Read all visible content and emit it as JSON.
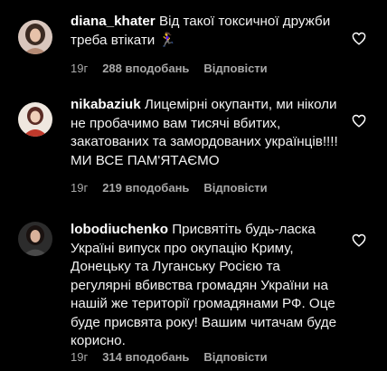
{
  "comments": [
    {
      "username": "diana_khater",
      "text": "Від такої токсичної дружби треба втікати 🏃‍♀️",
      "time": "19г",
      "likes": "288 вподобань",
      "reply": "Відповісти",
      "avatar_icon": "user-avatar-photo"
    },
    {
      "username": "nikabaziuk",
      "text": "Лицемірні окупанти, ми ніколи не пробачимо вам тисячі вбитих, закатованих та замордованих українців!!!! МИ ВСЕ ПАМ'ЯТАЄМО",
      "time": "19г",
      "likes": "219 вподобань",
      "reply": "Відповісти",
      "avatar_icon": "user-avatar-photo"
    },
    {
      "username": "lobodiuchenko",
      "text": "Присвятіть будь-ласка Україні випуск про окупацію Криму, Донецьку та Луганську Росією та регулярні вбивства громадян України на нашій же території громадянами РФ. Оце буде присвята року! Вашим читачам буде корисно.",
      "time": "19г",
      "likes": "314 вподобань",
      "reply": "Відповісти",
      "avatar_icon": "user-avatar-photo"
    }
  ],
  "like_icon": "heart-outline-icon",
  "colors": {
    "background": "#000000",
    "text": "#f2f2f2",
    "meta": "#a8a8a8"
  }
}
